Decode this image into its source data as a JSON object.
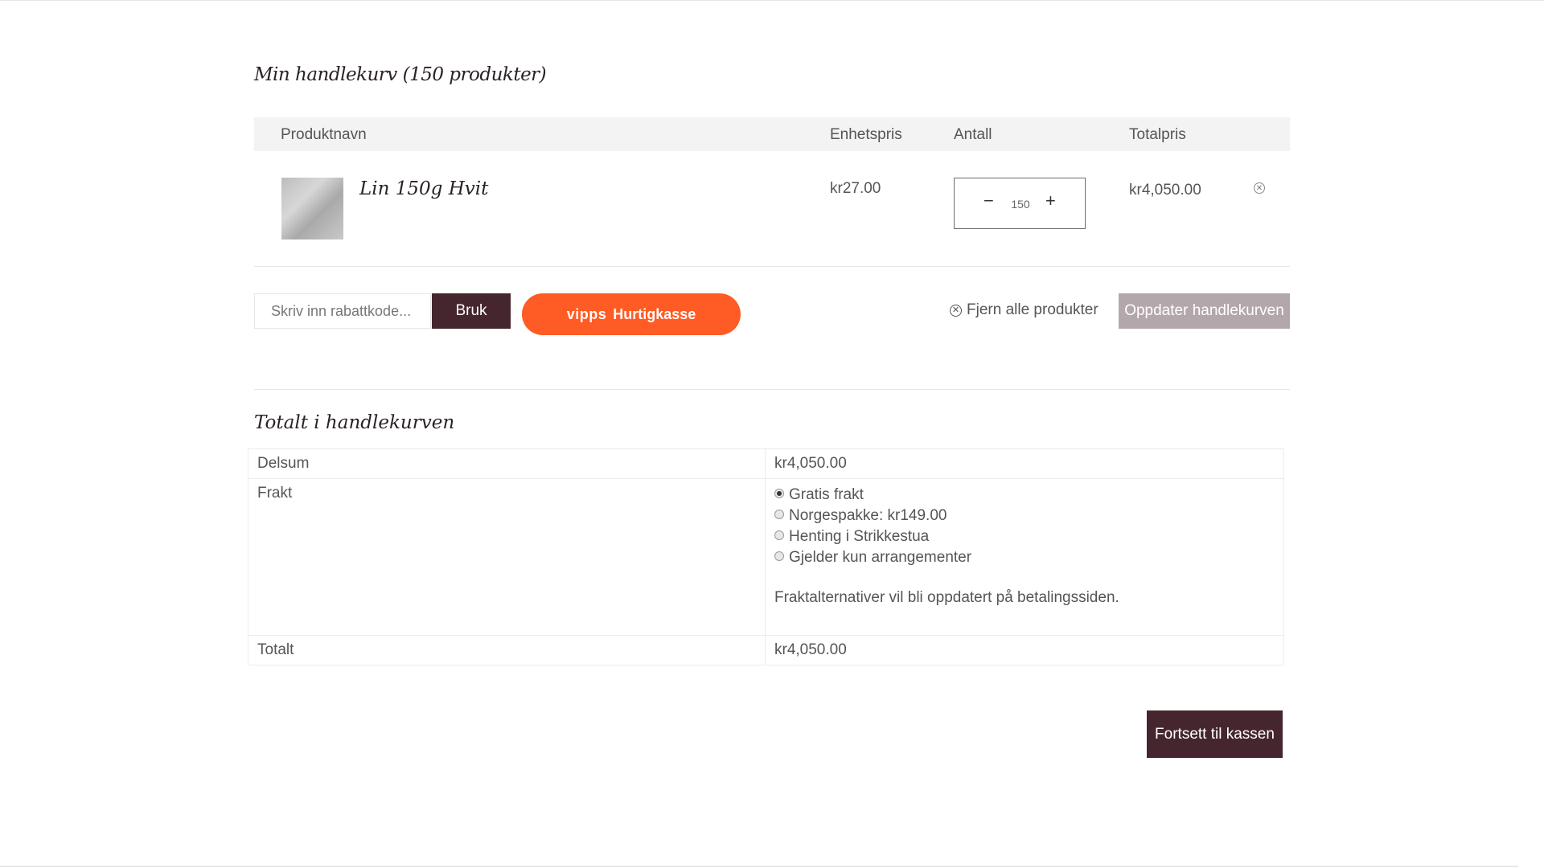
{
  "cart": {
    "title": "Min handlekurv (150 produkter)",
    "columns": {
      "product": "Produktnavn",
      "unit_price": "Enhetspris",
      "quantity": "Antall",
      "total": "Totalpris"
    },
    "items": [
      {
        "name": "Lin 150g Hvit",
        "unit_price": "kr27.00",
        "quantity": "150",
        "total": "kr4,050.00"
      }
    ],
    "qty_minus": "−",
    "qty_plus": "+",
    "remove_item_icon": "⊗",
    "coupon_placeholder": "Skriv inn rabattkode...",
    "apply_label": "Bruk",
    "vipps": {
      "brand": "vipps",
      "label": "Hurtigkasse",
      "color": "#ff5b24"
    },
    "remove_all_icon": "✕",
    "remove_all_label": "Fjern alle produkter",
    "update_label": "Oppdater handlekurven"
  },
  "totals": {
    "title": "Totalt i handlekurven",
    "subtotal_label": "Delsum",
    "subtotal_value": "kr4,050.00",
    "shipping_label": "Frakt",
    "shipping_options": [
      {
        "label": "Gratis frakt",
        "checked": true
      },
      {
        "label": "Norgespakke: kr149.00",
        "checked": false
      },
      {
        "label": "Henting i Strikkestua",
        "checked": false
      },
      {
        "label": "Gjelder kun arrangementer",
        "checked": false
      }
    ],
    "shipping_note": "Fraktalternativer vil bli oppdatert på betalingssiden.",
    "total_label": "Totalt",
    "total_value": "kr4,050.00"
  },
  "checkout_label": "Fortsett til kassen",
  "colors": {
    "primary": "#46262e",
    "update_button": "#b4a7ac",
    "vipps": "#ff5b24"
  }
}
